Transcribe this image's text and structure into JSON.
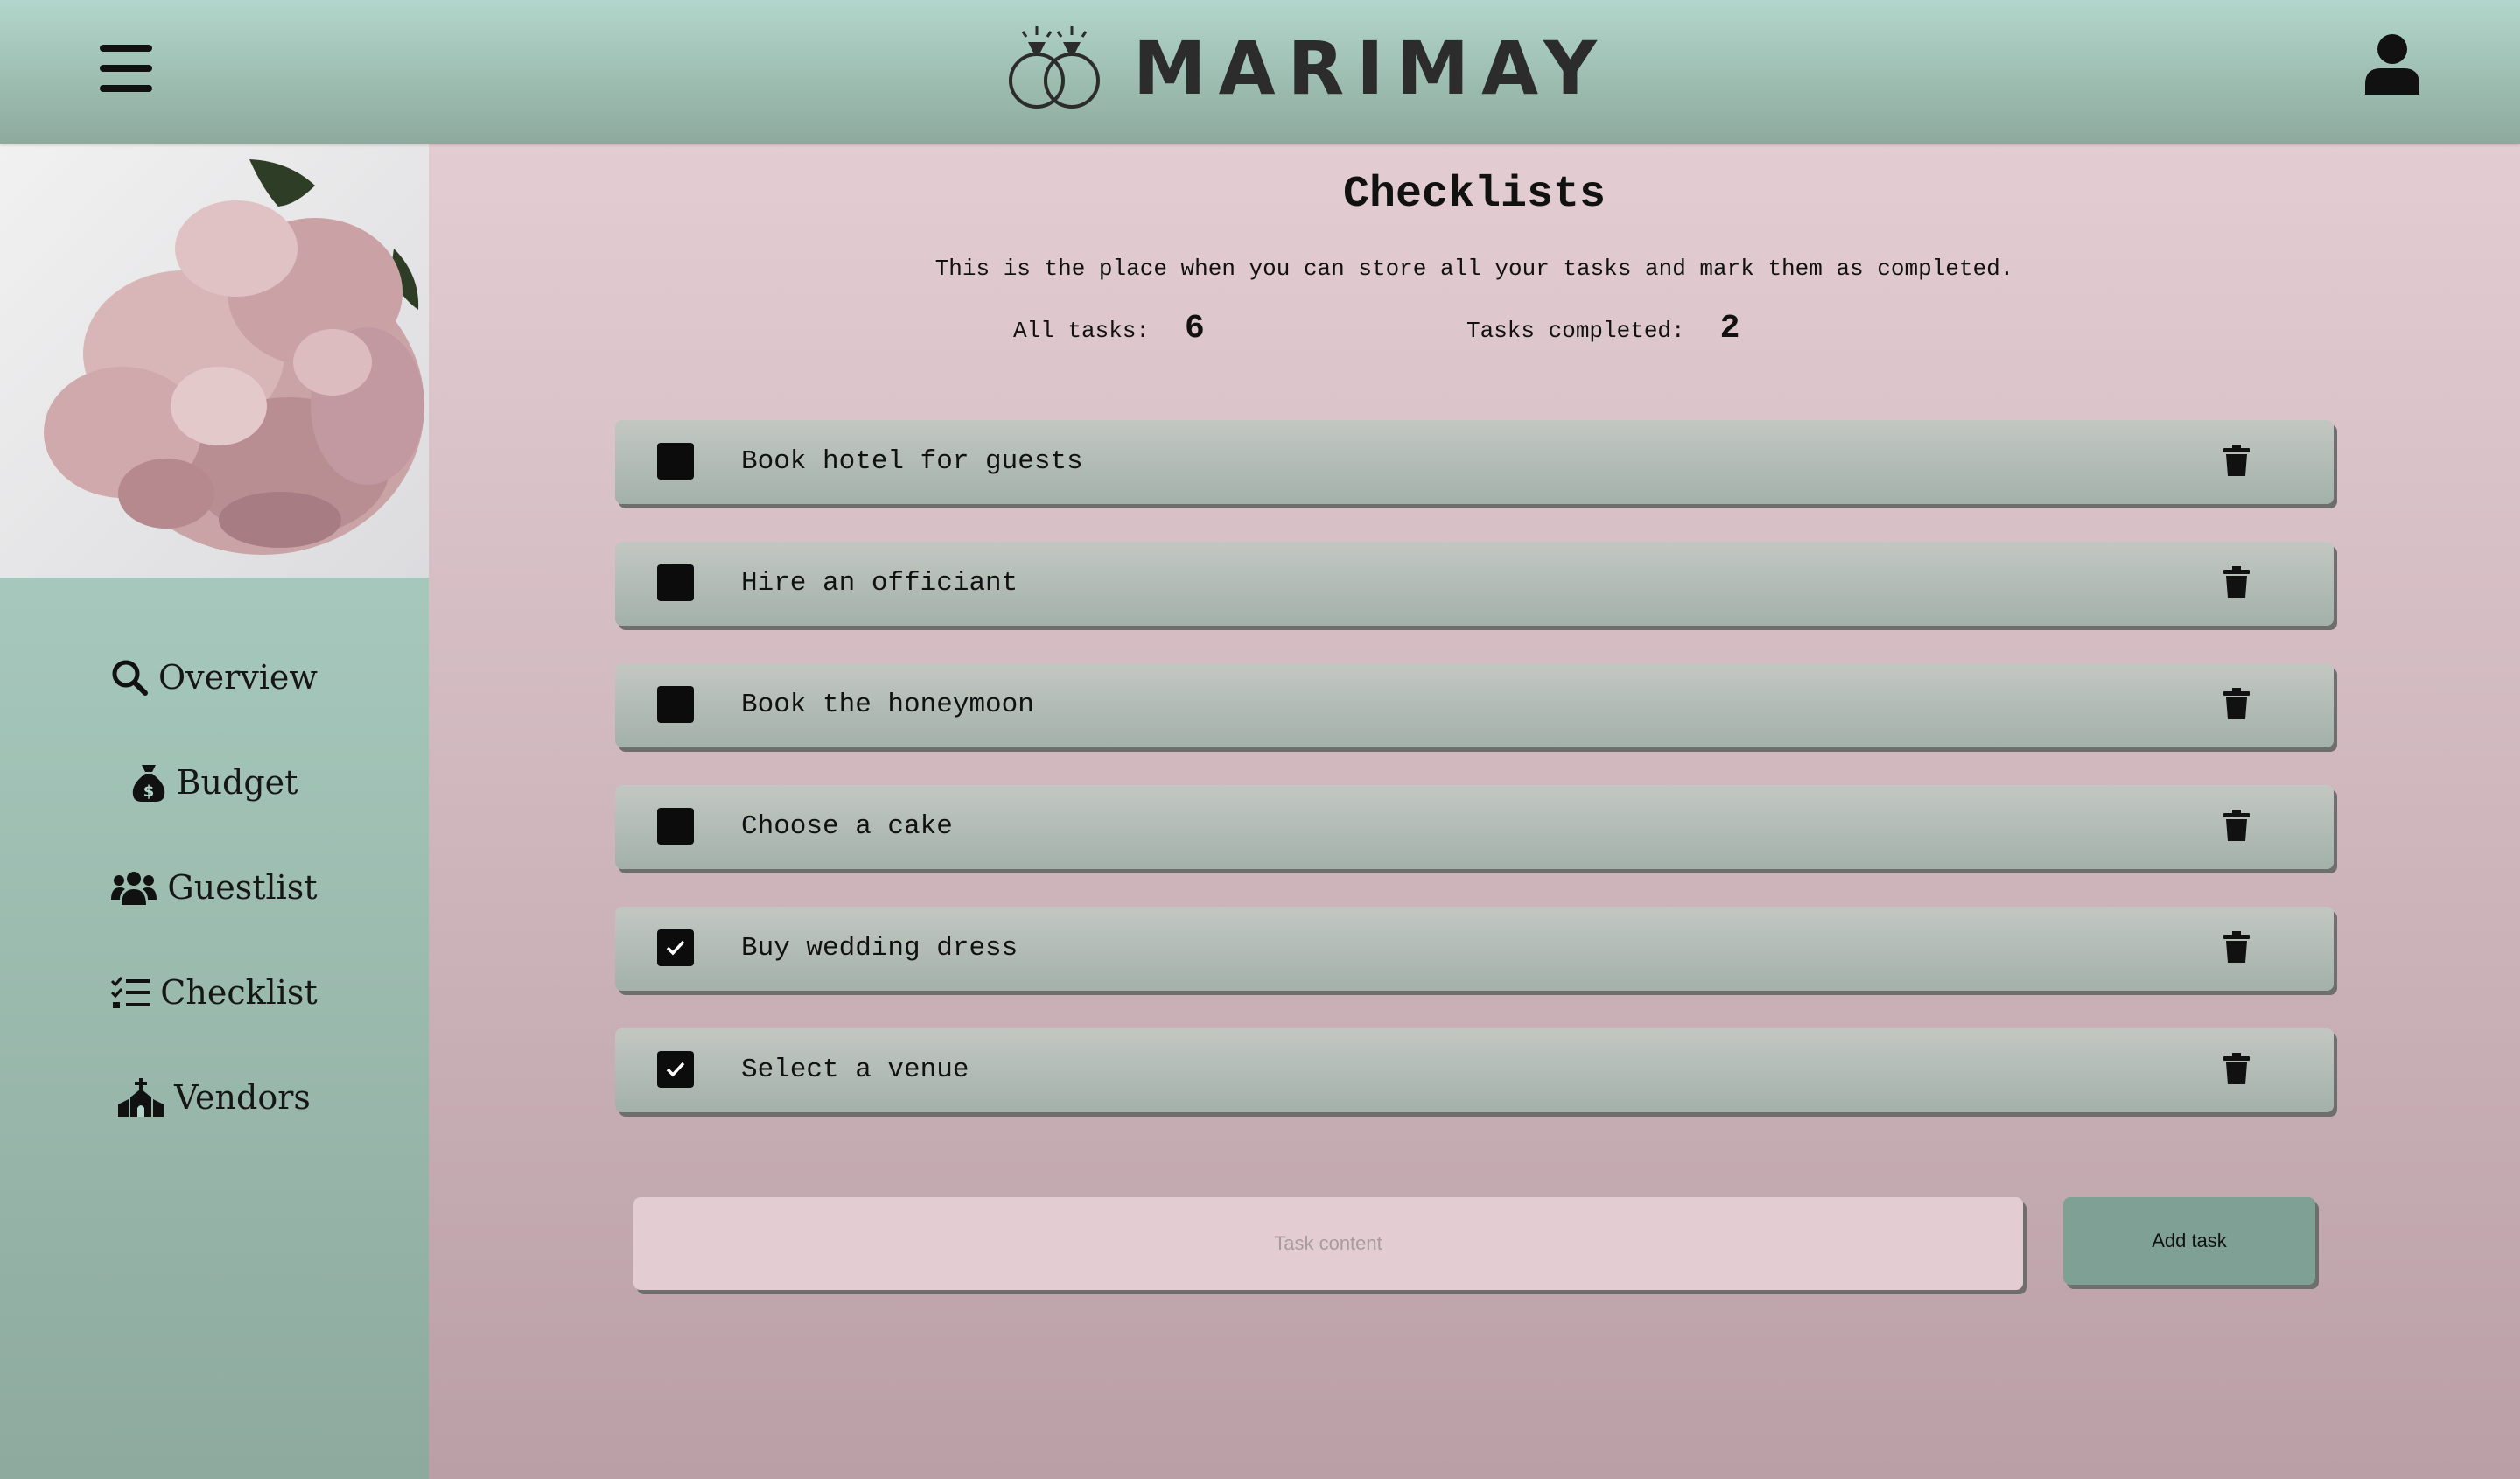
{
  "header": {
    "brand": "MARIMAY"
  },
  "sidebar": {
    "items": [
      {
        "label": "Overview",
        "icon": "search-icon"
      },
      {
        "label": "Budget",
        "icon": "money-bag-icon"
      },
      {
        "label": "Guestlist",
        "icon": "users-icon"
      },
      {
        "label": "Checklist",
        "icon": "checklist-icon"
      },
      {
        "label": "Vendors",
        "icon": "church-icon"
      }
    ]
  },
  "main": {
    "title": "Checklists",
    "description": "This is the place when you can store all your tasks and mark them as completed.",
    "stats": {
      "all_label": "All tasks:",
      "all_value": "6",
      "completed_label": "Tasks completed:",
      "completed_value": "2"
    },
    "tasks": [
      {
        "text": "Book hotel for guests",
        "completed": false
      },
      {
        "text": "Hire an officiant",
        "completed": false
      },
      {
        "text": "Book the honeymoon",
        "completed": false
      },
      {
        "text": "Choose a cake",
        "completed": false
      },
      {
        "text": "Buy wedding dress",
        "completed": true
      },
      {
        "text": "Select a venue",
        "completed": true
      }
    ],
    "input": {
      "placeholder": "Task content",
      "value": ""
    },
    "add_button_label": "Add task"
  }
}
